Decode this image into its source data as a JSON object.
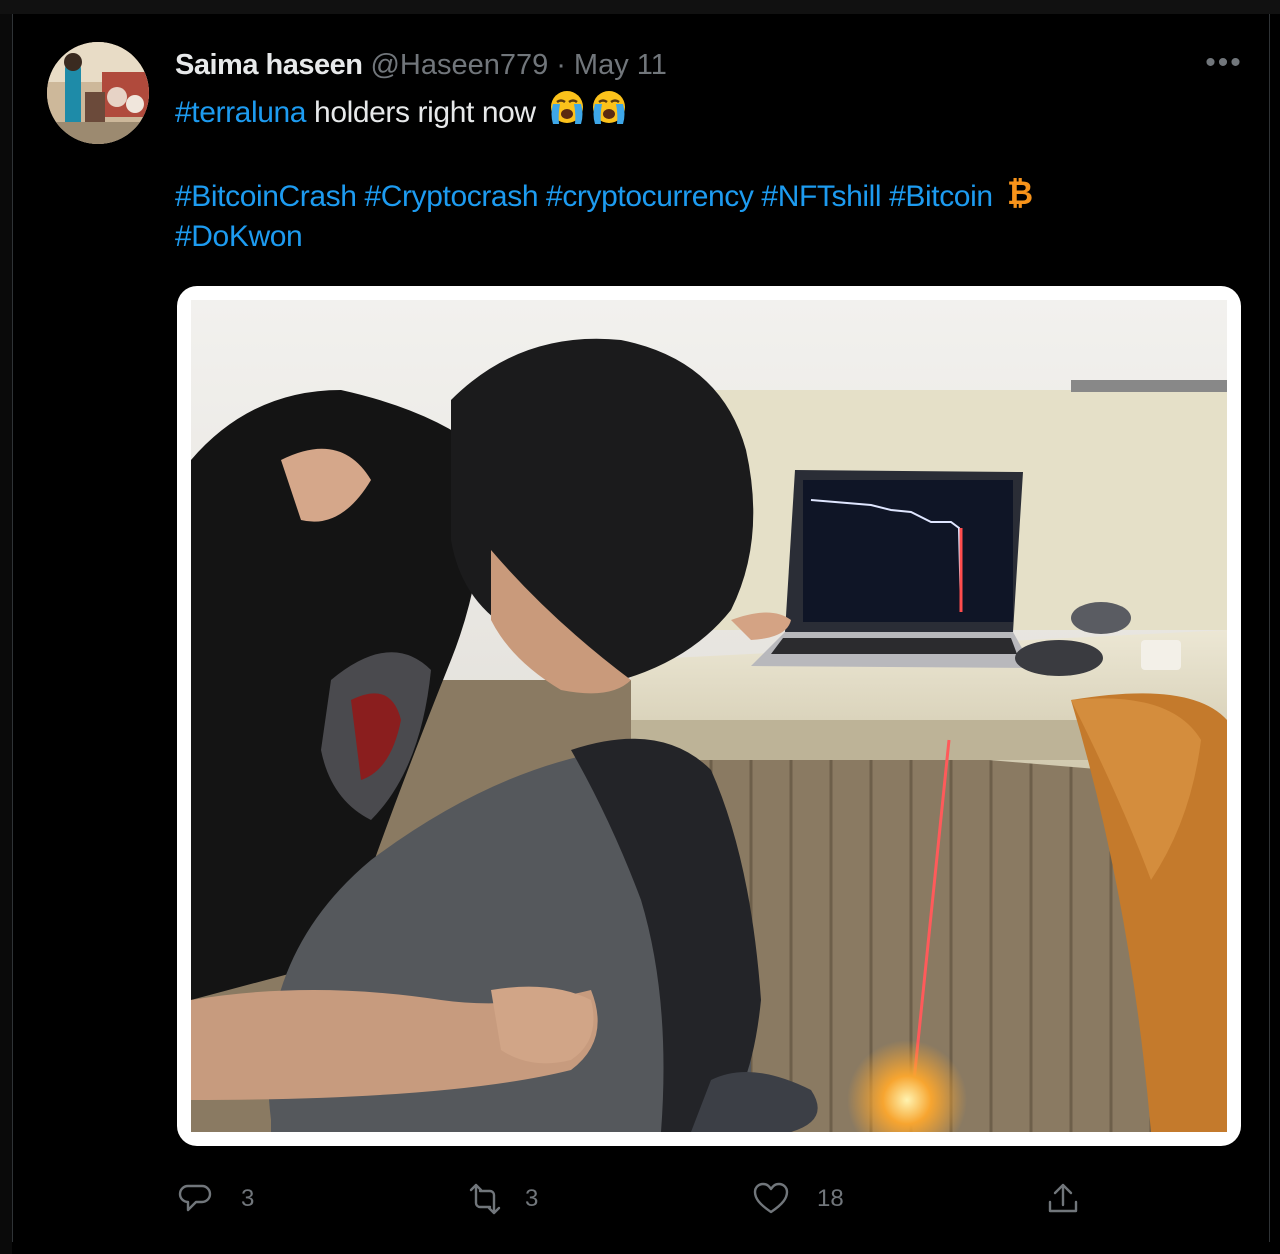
{
  "tweet": {
    "author_name": "Saima haseen",
    "handle": "@Haseen779",
    "separator": "·",
    "date": "May 11",
    "more_label": "•••",
    "line1": {
      "hashtag": "#terraluna",
      "text": " holders right now ",
      "emoji": [
        "loudly-crying-face",
        "loudly-crying-face"
      ]
    },
    "line2": [
      "#BitcoinCrash",
      "#Cryptocrash",
      "#cryptocurrency",
      "#NFTshill",
      "#Bitcoin"
    ],
    "line2_emoji": "bitcoin-icon",
    "line3": [
      "#DoKwon"
    ],
    "image": {
      "description_icon": "crying-crypto-holder-photo",
      "chart_trend": "crash"
    },
    "actions": {
      "reply_count": "3",
      "retweet_count": "3",
      "like_count": "18"
    }
  },
  "colors": {
    "background": "#000000",
    "text_primary": "#e7e9ea",
    "text_secondary": "#71767b",
    "link": "#1d9bf0",
    "bitcoin": "#f7931a"
  }
}
